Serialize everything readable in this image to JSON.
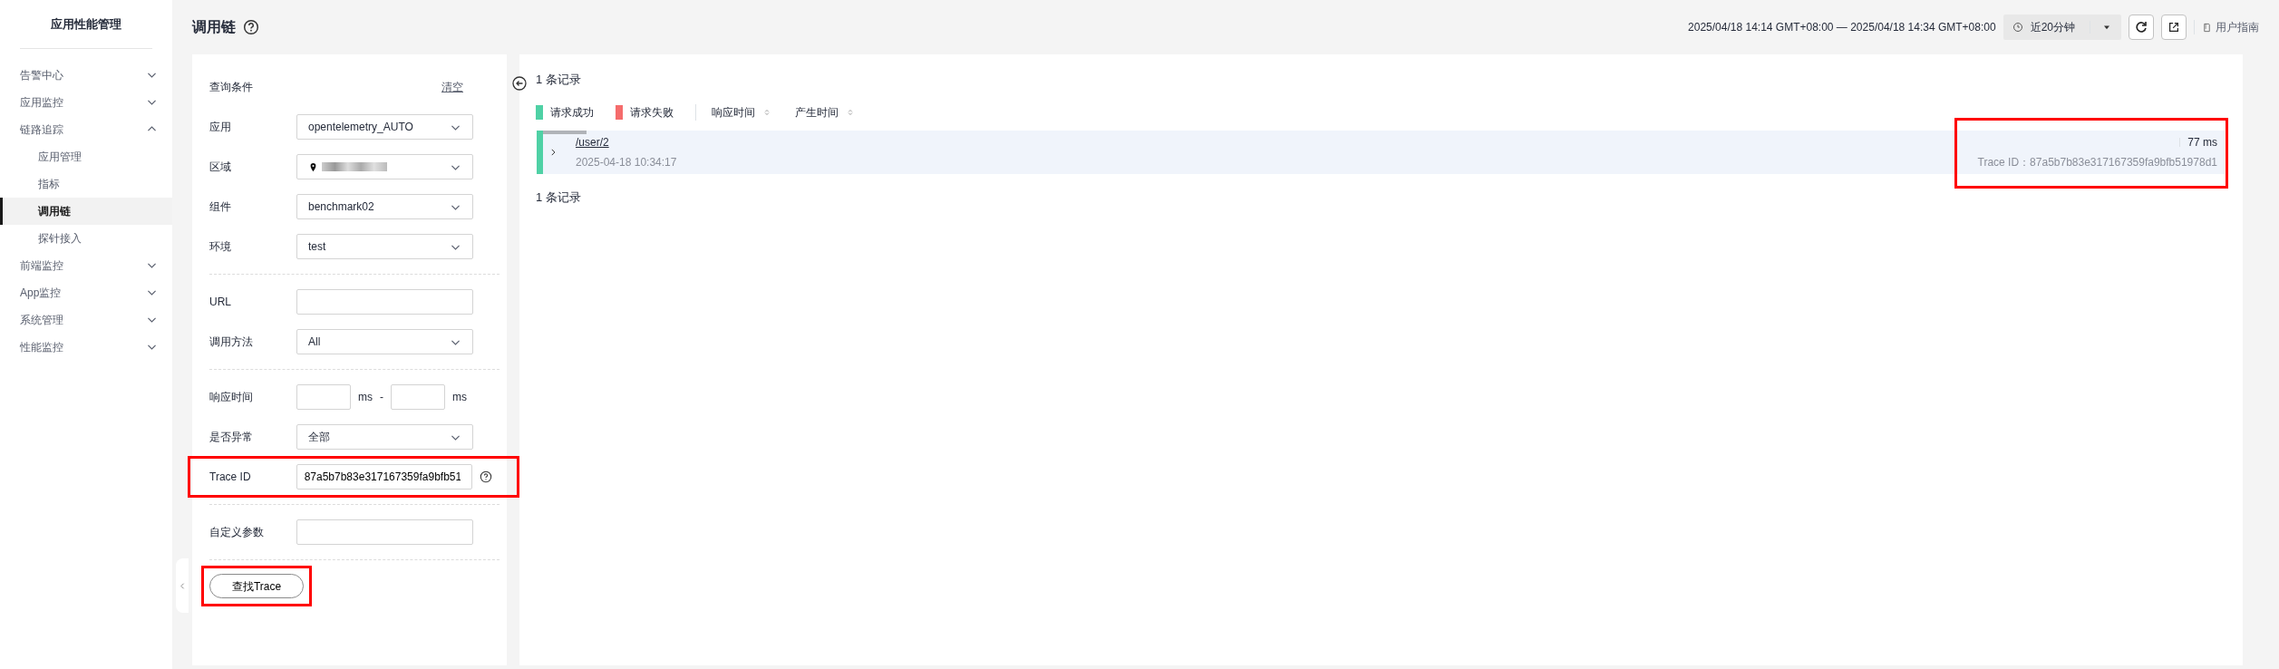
{
  "sidebar": {
    "title": "应用性能管理",
    "items": [
      {
        "label": "告警中心",
        "expanded": false,
        "selected": false
      },
      {
        "label": "应用监控",
        "expanded": false,
        "selected": false
      },
      {
        "label": "链路追踪",
        "expanded": true,
        "selected": false,
        "children": [
          {
            "label": "应用管理",
            "selected": false
          },
          {
            "label": "指标",
            "selected": false
          },
          {
            "label": "调用链",
            "selected": true
          },
          {
            "label": "探针接入",
            "selected": false
          }
        ]
      },
      {
        "label": "前端监控",
        "expanded": false,
        "selected": false
      },
      {
        "label": "App监控",
        "expanded": false,
        "selected": false
      },
      {
        "label": "系统管理",
        "expanded": false,
        "selected": false
      },
      {
        "label": "性能监控",
        "expanded": false,
        "selected": false
      }
    ]
  },
  "header": {
    "title": "调用链",
    "time_range": "2025/04/18 14:14 GMT+08:00 — 2025/04/18 14:34 GMT+08:00",
    "time_preset": "近20分钟",
    "guide_link": "用户指南"
  },
  "filters": {
    "title": "查询条件",
    "clear": "清空",
    "groups": [
      [
        {
          "label": "应用",
          "kind": "select",
          "value": "opentelemetry_AUTO",
          "highlighted": false
        },
        {
          "label": "区域",
          "kind": "location",
          "highlighted": false
        },
        {
          "label": "组件",
          "kind": "select",
          "value": "benchmark02",
          "highlighted": false
        },
        {
          "label": "环境",
          "kind": "select",
          "value": "test",
          "highlighted": false
        }
      ],
      [
        {
          "label": "URL",
          "kind": "text",
          "highlighted": false
        },
        {
          "label": "调用方法",
          "kind": "select",
          "value": "All",
          "highlighted": false
        }
      ],
      [
        {
          "label": "响应时间",
          "kind": "range",
          "unit_from": "ms",
          "separator": "-",
          "unit_to": "ms",
          "highlighted": false
        },
        {
          "label": "是否异常",
          "kind": "select",
          "value": "全部",
          "highlighted": false
        },
        {
          "label": "Trace ID",
          "kind": "help_text",
          "value": "87a5b7b83e317167359fa9bfb51",
          "highlighted": true
        }
      ],
      [
        {
          "label": "自定义参数",
          "kind": "text",
          "highlighted": false
        }
      ]
    ],
    "search_button": {
      "label": "查找Trace",
      "highlighted": true
    }
  },
  "results": {
    "count_top": "1 条记录",
    "legend": [
      {
        "label": "请求成功",
        "color": "#4fd1a5"
      },
      {
        "label": "请求失败",
        "color": "#f56c6c"
      }
    ],
    "sorts": [
      {
        "label": "响应时间"
      },
      {
        "label": "产生时间"
      }
    ],
    "rows": [
      {
        "path": "/user/2",
        "time": "2025-04-18 10:34:17",
        "duration": "77 ms",
        "trace_id": "Trace ID：87a5b7b83e317167359fa9bfb51978d1",
        "color": "#4fd1a5",
        "highlighted": true
      }
    ],
    "count_bottom": "1 条记录"
  }
}
